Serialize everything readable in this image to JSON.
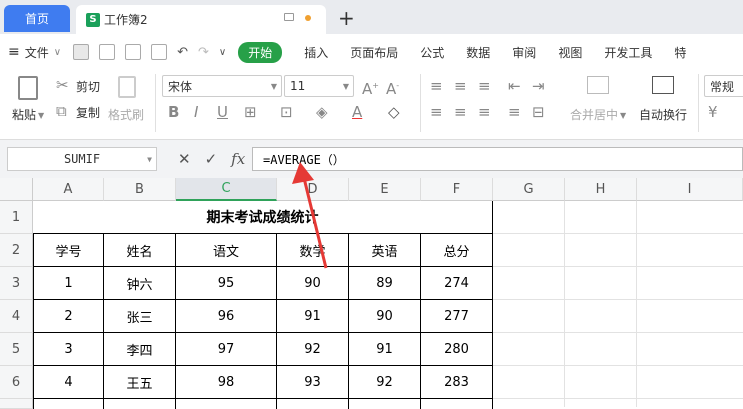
{
  "tabs": {
    "home": "首页",
    "doc_title": "工作簿2"
  },
  "menu": {
    "file": "文件",
    "items": [
      "开始",
      "插入",
      "页面布局",
      "公式",
      "数据",
      "审阅",
      "视图",
      "开发工具",
      "特"
    ]
  },
  "ribbon": {
    "paste": "粘贴",
    "cut": "剪切",
    "copy": "复制",
    "format_painter": "格式刷",
    "font_name": "宋体",
    "font_size": "11",
    "merge_center": "合并居中",
    "wrap_text": "自动换行",
    "number_format": "常规"
  },
  "formula_bar": {
    "name_box": "SUMIF",
    "formula": "=AVERAGE（）",
    "fx": "fx"
  },
  "grid": {
    "columns": [
      "A",
      "B",
      "C",
      "D",
      "E",
      "F",
      "G",
      "H",
      "I"
    ],
    "rows": [
      "1",
      "2",
      "3",
      "4",
      "5",
      "6"
    ],
    "title": "期末考试成绩统计",
    "headers": [
      "学号",
      "姓名",
      "语文",
      "数学",
      "英语",
      "总分"
    ],
    "data": [
      [
        "1",
        "钟六",
        "95",
        "90",
        "89",
        "274"
      ],
      [
        "2",
        "张三",
        "96",
        "91",
        "90",
        "277"
      ],
      [
        "3",
        "李四",
        "97",
        "92",
        "91",
        "280"
      ],
      [
        "4",
        "王五",
        "98",
        "93",
        "92",
        "283"
      ]
    ]
  },
  "colors": {
    "accent_green": "#27a048",
    "tab_blue": "#3f7cf0",
    "arrow_red": "#e53935"
  }
}
